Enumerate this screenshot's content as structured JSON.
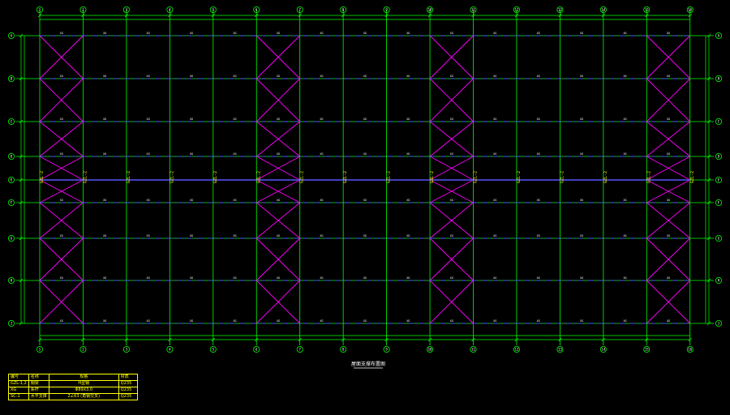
{
  "drawing": {
    "grid_x_labels": [
      "1",
      "2",
      "3",
      "4",
      "5",
      "6",
      "7",
      "8",
      "9",
      "10",
      "11",
      "12",
      "13",
      "14",
      "15",
      "16"
    ],
    "grid_y_labels": [
      "A",
      "B",
      "C",
      "D",
      "E",
      "F",
      "G",
      "H",
      "J"
    ],
    "gzl_label": "GZL-2",
    "tie_labels": [
      "XG",
      "XG",
      "XG",
      "XG",
      "XG",
      "XG",
      "XG",
      "XG",
      "XG",
      "XG",
      "XG",
      "XG",
      "XG",
      "XG",
      "XG"
    ],
    "title": "屋面支撑布置图",
    "colors": {
      "grid": "#00ff00",
      "bracing": "#ff00ff",
      "tie": "#5555ff",
      "text": "#ffffff",
      "table": "#ffff00"
    }
  },
  "legend": {
    "headers": [
      "编号",
      "名称",
      "规格",
      "材质"
    ],
    "rows": [
      [
        "GZL-1,2",
        "钢梁",
        "H型钢",
        "Q235"
      ],
      [
        "XG",
        "系杆",
        "Φ89X3.0",
        "Q235"
      ],
      [
        "SC-1",
        "水平支撑",
        "2∠63 (角钢交叉)",
        "Q235"
      ]
    ]
  }
}
